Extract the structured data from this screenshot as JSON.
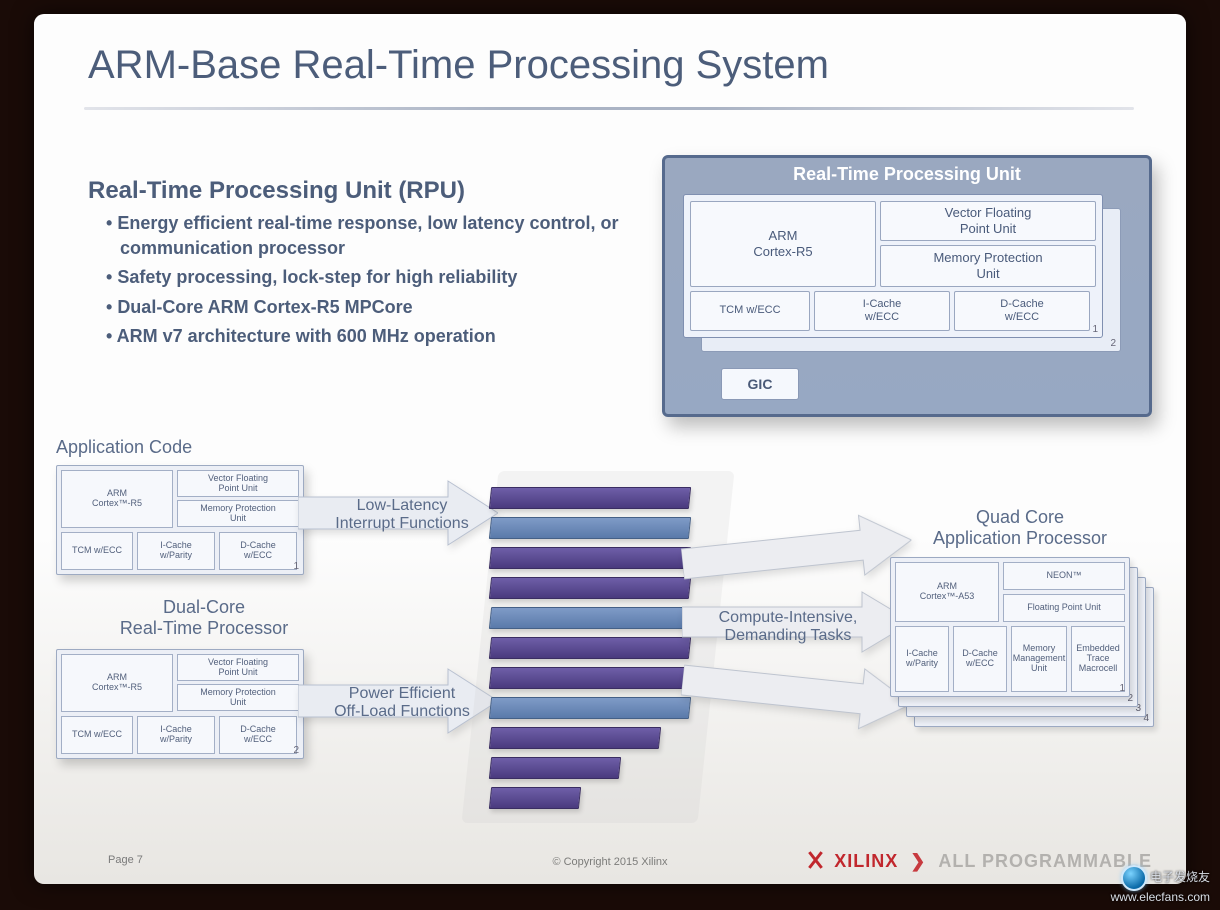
{
  "title": "ARM-Base Real-Time Processing System",
  "rpu_text": {
    "heading": "Real-Time Processing Unit (RPU)",
    "bullets": [
      "Energy efficient real-time response, low latency control, or communication processor",
      "Safety processing, lock-step for high reliability",
      "Dual-Core ARM Cortex-R5 MPCore",
      "ARM v7 architecture with 600 MHz operation"
    ]
  },
  "rpu_diagram": {
    "title": "Real-Time Processing Unit",
    "core_label": "ARM\nCortex-R5",
    "vfpu": "Vector Floating\nPoint Unit",
    "mpu": "Memory Protection\nUnit",
    "tcm": "TCM w/ECC",
    "icache": "I-Cache\nw/ECC",
    "dcache": "D-Cache\nw/ECC",
    "gic": "GIC",
    "core_numbers": [
      "1",
      "2"
    ]
  },
  "labels": {
    "application_code": "Application Code",
    "dual_core_rt": "Dual-Core\nReal-Time Processor",
    "low_latency": "Low-Latency\nInterrupt Functions",
    "power_eff": "Power Efficient\nOff-Load Functions",
    "compute": "Compute-Intensive,\nDemanding Tasks",
    "quad_core": "Quad Core\nApplication Processor"
  },
  "r5_small": {
    "core": "ARM\nCortex™-R5",
    "vfpu": "Vector Floating\nPoint Unit",
    "mpu": "Memory Protection\nUnit",
    "tcm": "TCM w/ECC",
    "icache": "I-Cache\nw/Parity",
    "dcache": "D-Cache\nw/ECC",
    "nums": [
      "1",
      "2"
    ]
  },
  "a53_block": {
    "core": "ARM\nCortex™-A53",
    "neon": "NEON™",
    "fpu": "Floating Point Unit",
    "icache": "I-Cache\nw/Parity",
    "dcache": "D-Cache\nw/ECC",
    "mmu": "Memory\nManagement\nUnit",
    "etm": "Embedded\nTrace\nMacrocell",
    "nums": [
      "1",
      "2",
      "3",
      "4"
    ]
  },
  "bar_colors": [
    "purple",
    "blue",
    "purple",
    "purple",
    "blue",
    "purple",
    "purple",
    "blue",
    "purple",
    "purple",
    "purple"
  ],
  "footer": {
    "page": "Page 7",
    "copyright": "© Copyright 2015 Xilinx",
    "brand": "XILINX",
    "tagline": "ALL PROGRAMMABLE"
  },
  "watermark": {
    "line1": "电子发烧友",
    "line2": "www.elecfans.com"
  },
  "colors": {
    "heading": "#4c5d7a",
    "diagram_border": "#566a8d",
    "xilinx_red": "#c1272d"
  }
}
